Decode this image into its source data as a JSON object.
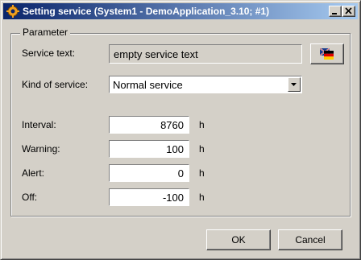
{
  "window": {
    "title": "Setting service (System1 - DemoApplication_3.10; #1)"
  },
  "group": {
    "legend": "Parameter"
  },
  "service_text": {
    "label": "Service text:",
    "value": "empty service text",
    "language_icon": "flag-icon"
  },
  "kind_of_service": {
    "label": "Kind of service:",
    "selected": "Normal service"
  },
  "fields": [
    {
      "label": "Interval:",
      "value": "8760",
      "unit": "h"
    },
    {
      "label": "Warning:",
      "value": "100",
      "unit": "h"
    },
    {
      "label": "Alert:",
      "value": "0",
      "unit": "h"
    },
    {
      "label": "Off:",
      "value": "-100",
      "unit": "h"
    }
  ],
  "buttons": {
    "ok": "OK",
    "cancel": "Cancel"
  }
}
